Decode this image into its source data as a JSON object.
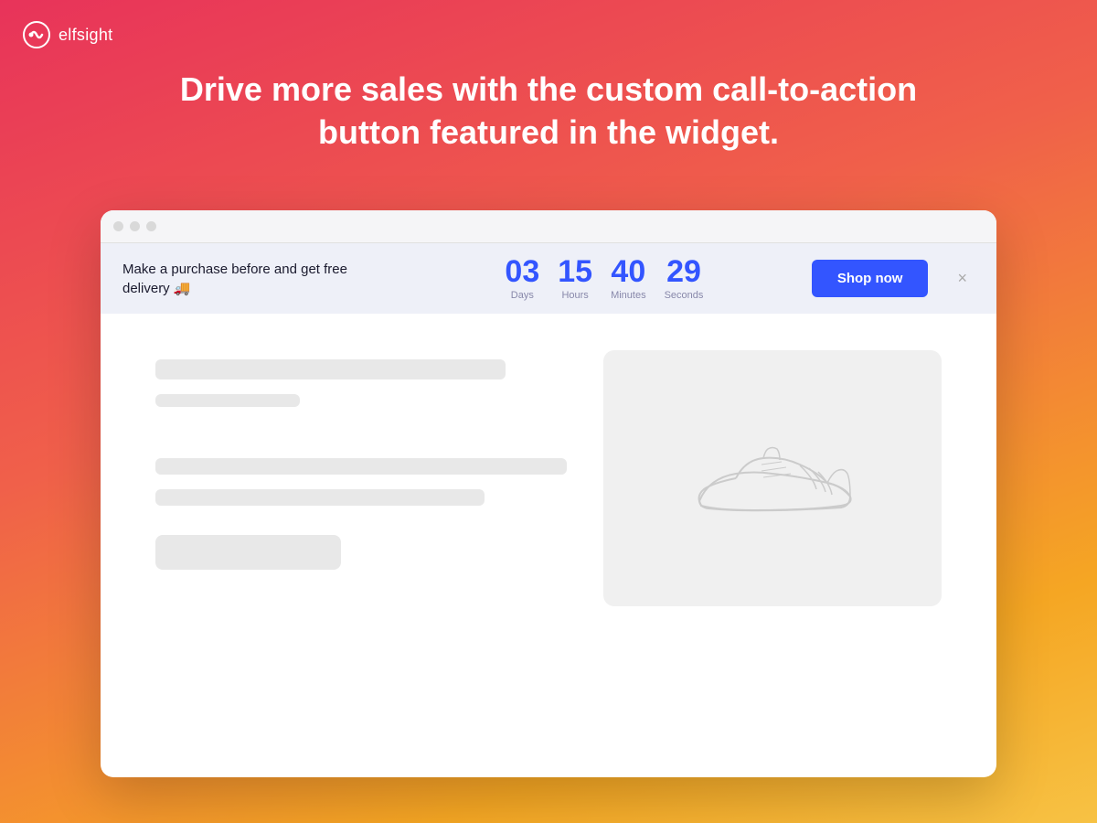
{
  "logo": {
    "text": "elfsight"
  },
  "headline": {
    "line1": "Drive more sales with the custom call-to-action",
    "line2": "button featured in the widget."
  },
  "browser": {
    "dots": [
      "red",
      "yellow",
      "green"
    ]
  },
  "banner": {
    "message": "Make a purchase before and get free delivery 🚚",
    "countdown": {
      "days": {
        "value": "03",
        "label": "Days"
      },
      "hours": {
        "value": "15",
        "label": "Hours"
      },
      "minutes": {
        "value": "40",
        "label": "Minutes"
      },
      "seconds": {
        "value": "29",
        "label": "Seconds"
      }
    },
    "cta_label": "Shop now",
    "close_label": "×"
  },
  "colors": {
    "accent": "#3355ff",
    "banner_bg": "#eef0f8"
  }
}
